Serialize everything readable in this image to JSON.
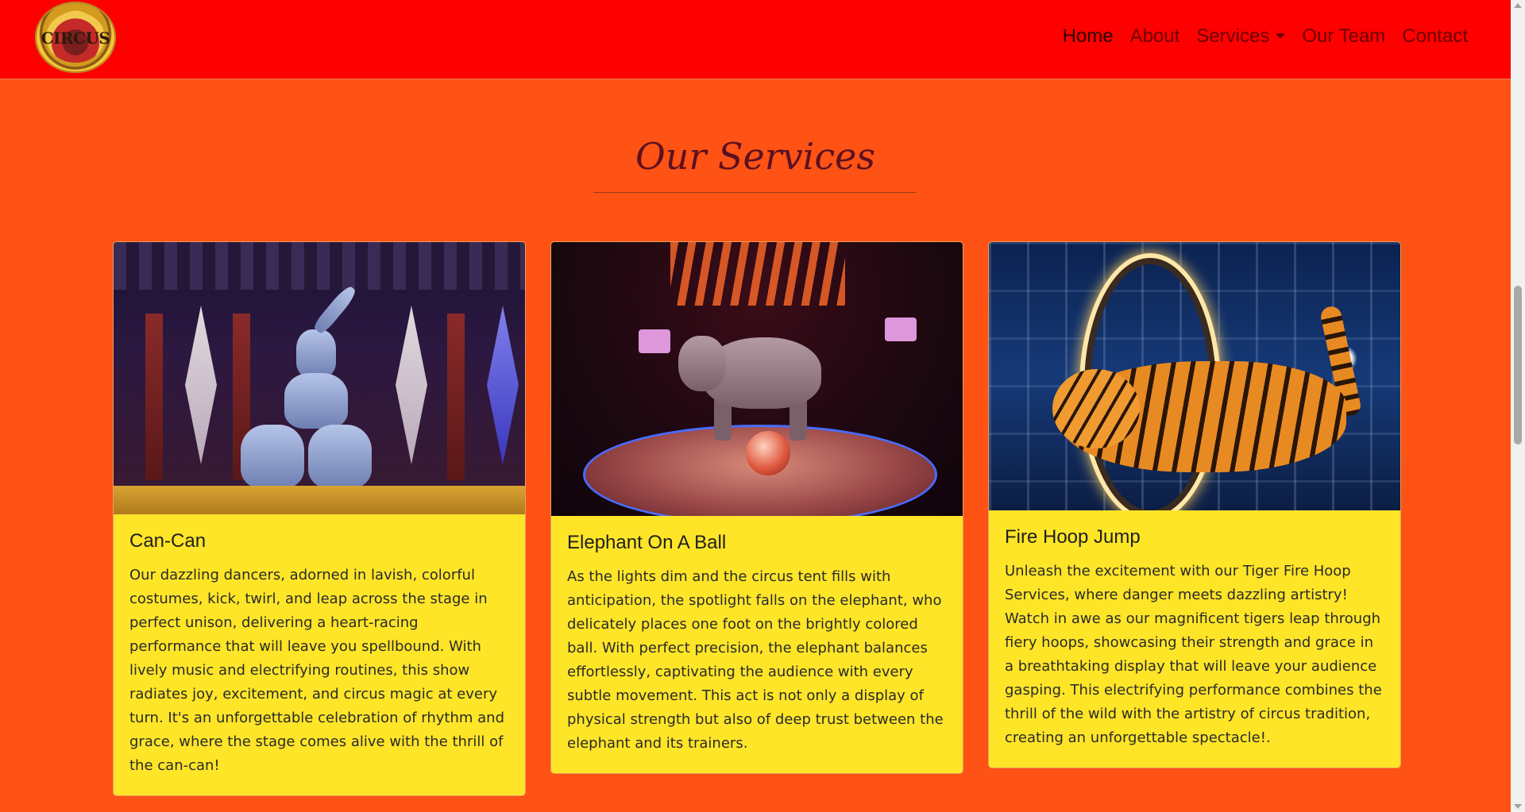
{
  "brand": {
    "logo_text": "CIRCUS",
    "logo_icon": "circus-logo"
  },
  "nav": {
    "items": [
      {
        "label": "Home",
        "active": true
      },
      {
        "label": "About",
        "active": false
      },
      {
        "label": "Services",
        "active": false,
        "dropdown": true
      },
      {
        "label": "Our Team",
        "active": false
      },
      {
        "label": "Contact",
        "active": false
      }
    ],
    "dropdown_icon": "caret-down-icon"
  },
  "services": {
    "title": "Our Services",
    "cards": [
      {
        "title": "Can-Can",
        "text": "Our dazzling dancers, adorned in lavish, colorful costumes, kick, twirl, and leap across the stage in perfect unison, delivering a heart-racing performance that will leave you spellbound. With lively music and electrifying routines, this show radiates joy, excitement, and circus magic at every turn. It's an unforgettable celebration of rhythm and grace, where the stage comes alive with the thrill of the can-can!"
      },
      {
        "title": "Elephant On A Ball",
        "text": "As the lights dim and the circus tent fills with anticipation, the spotlight falls on the elephant, who delicately places one foot on the brightly colored ball. With perfect precision, the elephant balances effortlessly, captivating the audience with every subtle movement. This act is not only a display of physical strength but also of deep trust between the elephant and its trainers."
      },
      {
        "title": "Fire Hoop Jump",
        "text": "Unleash the excitement with our Tiger Fire Hoop Services, where danger meets dazzling artistry! Watch in awe as our magnificent tigers leap through fiery hoops, showcasing their strength and grace in a breathtaking display that will leave your audience gasping. This electrifying performance combines the thrill of the wild with the artistry of circus tradition, creating an unforgettable spectacle!."
      }
    ]
  },
  "colors": {
    "navbar": "#ff0000",
    "page_bg": "#ff5215",
    "card_bg": "#ffe528",
    "title": "#5c1020"
  }
}
